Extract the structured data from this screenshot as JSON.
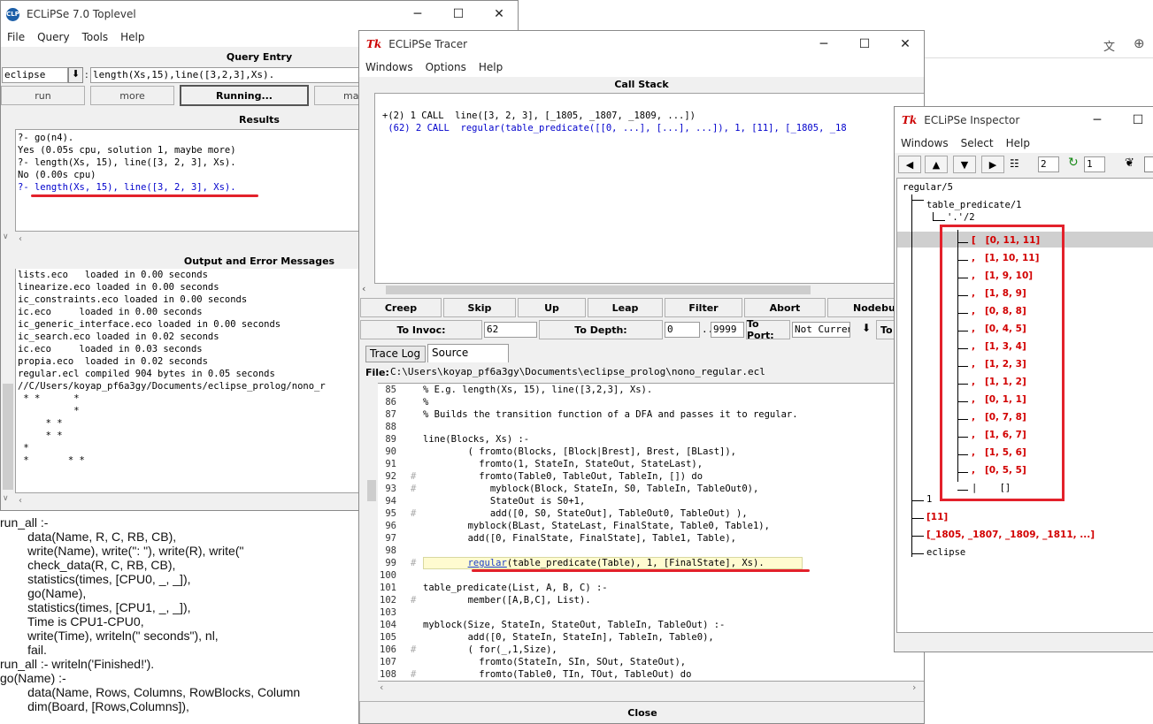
{
  "toplevel": {
    "title": "ECLiPSe 7.0 Toplevel",
    "menu": [
      "File",
      "Query",
      "Tools",
      "Help"
    ],
    "query_entry_heading": "Query Entry",
    "module": "eclipse",
    "query": "length(Xs,15),line([3,2,3],Xs).",
    "buttons": {
      "run": "run",
      "more": "more",
      "running": "Running...",
      "make": "make"
    },
    "results_heading": "Results",
    "results_lines": [
      "?- go(n4).",
      "Yes (0.05s cpu, solution 1, maybe more)",
      "?- length(Xs, 15), line([3, 2, 3], Xs).",
      "No (0.00s cpu)",
      "?- length(Xs, 15), line([3, 2, 3], Xs)."
    ],
    "output_heading": "Output and Error Messages",
    "output_lines": [
      "lists.eco   loaded in 0.00 seconds",
      "linearize.eco loaded in 0.00 seconds",
      "ic_constraints.eco loaded in 0.00 seconds",
      "ic.eco     loaded in 0.00 seconds",
      "ic_generic_interface.eco loaded in 0.00 seconds",
      "ic_search.eco loaded in 0.02 seconds",
      "ic.eco     loaded in 0.03 seconds",
      "propia.eco  loaded in 0.02 seconds",
      "regular.ecl compiled 904 bytes in 0.05 seconds",
      "//C/Users/koyap_pf6a3gy/Documents/eclipse_prolog/nono_r",
      " * *      *",
      "          *",
      "     * *",
      "     * *",
      " *",
      " *       * *"
    ]
  },
  "background_editor": {
    "lines": [
      "run_all :-",
      "        data(Name, R, C, RB, CB),",
      "        write(Name), write(\": \"), write(R), write(\"",
      "        check_data(R, C, RB, CB),",
      "        statistics(times, [CPU0, _, _]),",
      "        go(Name),",
      "        statistics(times, [CPU1, _, _]),",
      "        Time is CPU1-CPU0,",
      "        write(Time), writeln(\" seconds\"), nl,",
      "        fail.",
      "run_all :- writeln('Finished!').",
      "",
      "go(Name) :-",
      "        data(Name, Rows, Columns, RowBlocks, Column",
      "        dim(Board, [Rows,Columns]),"
    ]
  },
  "tracer": {
    "title": "ECLiPSe Tracer",
    "menu": [
      "Windows",
      "Options",
      "Help"
    ],
    "call_stack_heading": "Call Stack",
    "call_stack": [
      "+(2) 1 CALL  line([3, 2, 3], [_1805, _1807, _1809, ...])",
      " (62) 2 CALL  regular(table_predicate([[0, ...], [...], ...]), 1, [11], [_1805, _18"
    ],
    "buttons": [
      "Creep",
      "Skip",
      "Up",
      "Leap",
      "Filter",
      "Abort",
      "Nodebug"
    ],
    "to_invoc_label": "To Invoc:",
    "to_invoc_value": "62",
    "to_depth_label": "To Depth:",
    "depth_from": "0",
    "depth_sep": "..",
    "depth_to": "9999",
    "to_port_label": "To Port:",
    "port_value": "Not Curren",
    "to_label": "To",
    "tabs": [
      "Trace Log",
      "Source Context"
    ],
    "file_label": "File:",
    "file_path": "C:\\Users\\koyap_pf6a3gy\\Documents\\eclipse_prolog\\nono_regular.ecl",
    "source": [
      {
        "n": "85",
        "t": "% E.g. length(Xs, 15), line([3,2,3], Xs)."
      },
      {
        "n": "86",
        "t": "%"
      },
      {
        "n": "87",
        "t": "% Builds the transition function of a DFA and passes it to regular."
      },
      {
        "n": "88",
        "t": ""
      },
      {
        "n": "89",
        "t": "line(Blocks, Xs) :-"
      },
      {
        "n": "90",
        "t": "        ( fromto(Blocks, [Block|Brest], Brest, [BLast]),"
      },
      {
        "n": "91",
        "t": "          fromto(1, StateIn, StateOut, StateLast),"
      },
      {
        "n": "92",
        "t": "          fromto(Table0, TableOut, TableIn, []) do"
      },
      {
        "n": "93",
        "t": "            myblock(Block, StateIn, S0, TableIn, TableOut0),"
      },
      {
        "n": "94",
        "t": "            StateOut is S0+1,"
      },
      {
        "n": "95",
        "t": "            add([0, S0, StateOut], TableOut0, TableOut) ),"
      },
      {
        "n": "96",
        "t": "        myblock(BLast, StateLast, FinalState, Table0, Table1),"
      },
      {
        "n": "97",
        "t": "        add([0, FinalState, FinalState], Table1, Table),"
      },
      {
        "n": "98",
        "t": ""
      },
      {
        "n": "99",
        "t": "        regular(table_predicate(Table), 1, [FinalState], Xs)."
      },
      {
        "n": "100",
        "t": ""
      },
      {
        "n": "101",
        "t": "table_predicate(List, A, B, C) :-"
      },
      {
        "n": "102",
        "t": "        member([A,B,C], List)."
      },
      {
        "n": "103",
        "t": ""
      },
      {
        "n": "104",
        "t": "myblock(Size, StateIn, StateOut, TableIn, TableOut) :-"
      },
      {
        "n": "105",
        "t": "        add([0, StateIn, StateIn], TableIn, Table0),"
      },
      {
        "n": "106",
        "t": "        ( for(_,1,Size),"
      },
      {
        "n": "107",
        "t": "          fromto(StateIn, SIn, SOut, StateOut),"
      },
      {
        "n": "108",
        "t": "          fromto(Table0, TIn, TOut, TableOut) do"
      }
    ],
    "close": "Close"
  },
  "inspector": {
    "title": "ECLiPSe Inspector",
    "menu": [
      "Windows",
      "Select",
      "Help"
    ],
    "spin1": "2",
    "spin2": "1",
    "tree": {
      "root": "regular/5",
      "pred": "table_predicate/1",
      "list_functor": "'.'/2",
      "items": [
        "[0, 11, 11]",
        "[1, 10, 11]",
        "[1, 9, 10]",
        "[1, 8, 9]",
        "[0, 8, 8]",
        "[0, 4, 5]",
        "[1, 3, 4]",
        "[1, 2, 3]",
        "[1, 1, 2]",
        "[0, 1, 1]",
        "[0, 7, 8]",
        "[1, 6, 7]",
        "[1, 5, 6]",
        "[0, 5, 5]"
      ],
      "first_prefix": "[",
      "comma": ",",
      "tail": "[]",
      "arg2": "1",
      "arg3": "[11]",
      "arg4": "[_1805, _1807, _1809, _1811, ...]",
      "module": "eclipse"
    }
  },
  "colors": {
    "accent_red": "#e3212b",
    "tree_red": "#d20000",
    "link_blue": "#0000cc"
  }
}
